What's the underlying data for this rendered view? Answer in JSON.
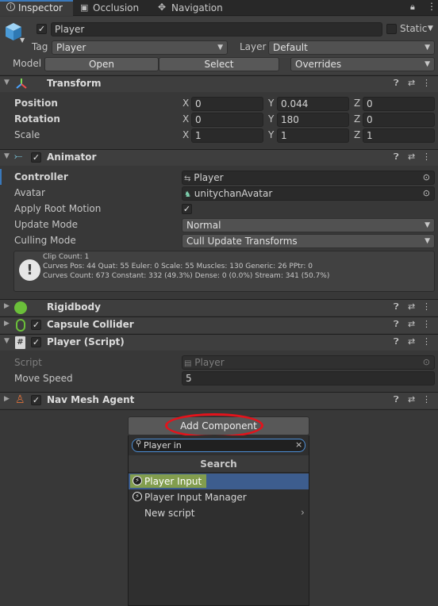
{
  "tabs": [
    {
      "label": "Inspector",
      "icon": "info-icon"
    },
    {
      "label": "Occlusion",
      "icon": "cube-icon"
    },
    {
      "label": "Navigation",
      "icon": "compass-icon"
    }
  ],
  "object": {
    "name": "Player",
    "static_label": "Static",
    "tag_label": "Tag",
    "tag_value": "Player",
    "layer_label": "Layer",
    "layer_value": "Default",
    "model_label": "Model",
    "open_label": "Open",
    "select_label": "Select",
    "overrides_label": "Overrides"
  },
  "transform": {
    "title": "Transform",
    "rows": [
      {
        "label": "Position",
        "x": "0",
        "y": "0.044",
        "z": "0"
      },
      {
        "label": "Rotation",
        "x": "0",
        "y": "180",
        "z": "0"
      },
      {
        "label": "Scale",
        "x": "1",
        "y": "1",
        "z": "1"
      }
    ],
    "axes": {
      "x": "X",
      "y": "Y",
      "z": "Z"
    }
  },
  "animator": {
    "title": "Animator",
    "controller_label": "Controller",
    "controller_value": "Player",
    "avatar_label": "Avatar",
    "avatar_value": "unitychanAvatar",
    "root_motion_label": "Apply Root Motion",
    "update_mode_label": "Update Mode",
    "update_mode_value": "Normal",
    "culling_mode_label": "Culling Mode",
    "culling_mode_value": "Cull Update Transforms",
    "info_lines": [
      "Clip Count: 1",
      "Curves Pos: 44 Quat: 55 Euler: 0 Scale: 55 Muscles: 130 Generic: 26 PPtr: 0",
      "Curves Count: 673 Constant: 332 (49.3%) Dense: 0 (0.0%) Stream: 341 (50.7%)"
    ]
  },
  "rigidbody": {
    "title": "Rigidbody"
  },
  "capsule": {
    "title": "Capsule Collider"
  },
  "player_script": {
    "title": "Player (Script)",
    "script_label": "Script",
    "script_value": "Player",
    "move_speed_label": "Move Speed",
    "move_speed_value": "5"
  },
  "navmesh": {
    "title": "Nav Mesh Agent"
  },
  "add_component": {
    "button_label": "Add Component",
    "search_value": "Player in",
    "section_title": "Search",
    "results": [
      {
        "label": "Player Input",
        "selected": true
      },
      {
        "label": "Player Input Manager",
        "selected": false
      },
      {
        "label": "New script",
        "selected": false,
        "has_submenu": true
      }
    ]
  },
  "colors": {
    "selection": "#3d5d8e",
    "highlight_yellow": "#d6ec00",
    "annotation_red": "#e3131b"
  }
}
